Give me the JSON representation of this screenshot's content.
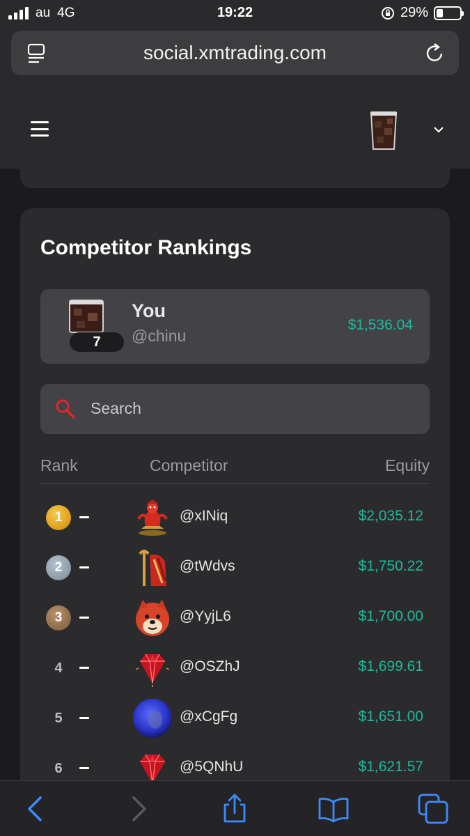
{
  "status_bar": {
    "carrier": "au",
    "network": "4G",
    "time": "19:22",
    "battery_percent": "29%",
    "battery_level": 0.29
  },
  "browser": {
    "url": "social.xmtrading.com"
  },
  "header": {
    "menu_icon": "hamburger-icon",
    "avatar_icon": "iced-cola-avatar",
    "dropdown_icon": "chevron-down-icon"
  },
  "rankings": {
    "title": "Competitor Rankings",
    "you": {
      "name": "You",
      "handle": "@chinu",
      "rank": "7",
      "equity": "$1,536.04"
    },
    "search": {
      "placeholder": "Search",
      "icon": "search-icon"
    },
    "columns": {
      "rank": "Rank",
      "competitor": "Competitor",
      "equity": "Equity"
    },
    "rows": [
      {
        "rank": "1",
        "change": "–",
        "handle": "@xINiq",
        "equity": "$2,035.12",
        "avatar": "genie-avatar"
      },
      {
        "rank": "2",
        "change": "–",
        "handle": "@tWdvs",
        "equity": "$1,750.22",
        "avatar": "pharaoh-staff-avatar"
      },
      {
        "rank": "3",
        "change": "–",
        "handle": "@YyjL6",
        "equity": "$1,700.00",
        "avatar": "shiba-dog-avatar"
      },
      {
        "rank": "4",
        "change": "–",
        "handle": "@OSZhJ",
        "equity": "$1,699.61",
        "avatar": "ruby-gem-avatar"
      },
      {
        "rank": "5",
        "change": "–",
        "handle": "@xCgFg",
        "equity": "$1,651.00",
        "avatar": "blue-photo-avatar"
      },
      {
        "rank": "6",
        "change": "–",
        "handle": "@5QNhU",
        "equity": "$1,621.57",
        "avatar": "ruby-gem-avatar"
      }
    ]
  },
  "toolbar": {
    "icons": [
      "back-icon",
      "forward-icon",
      "share-icon",
      "bookmarks-icon",
      "tabs-icon"
    ]
  },
  "colors": {
    "accent_green": "#1fb89a",
    "toolbar_blue": "#3d8bff",
    "gold": "#f0b429",
    "silver": "#9aa8b5",
    "bronze": "#9a7550"
  }
}
